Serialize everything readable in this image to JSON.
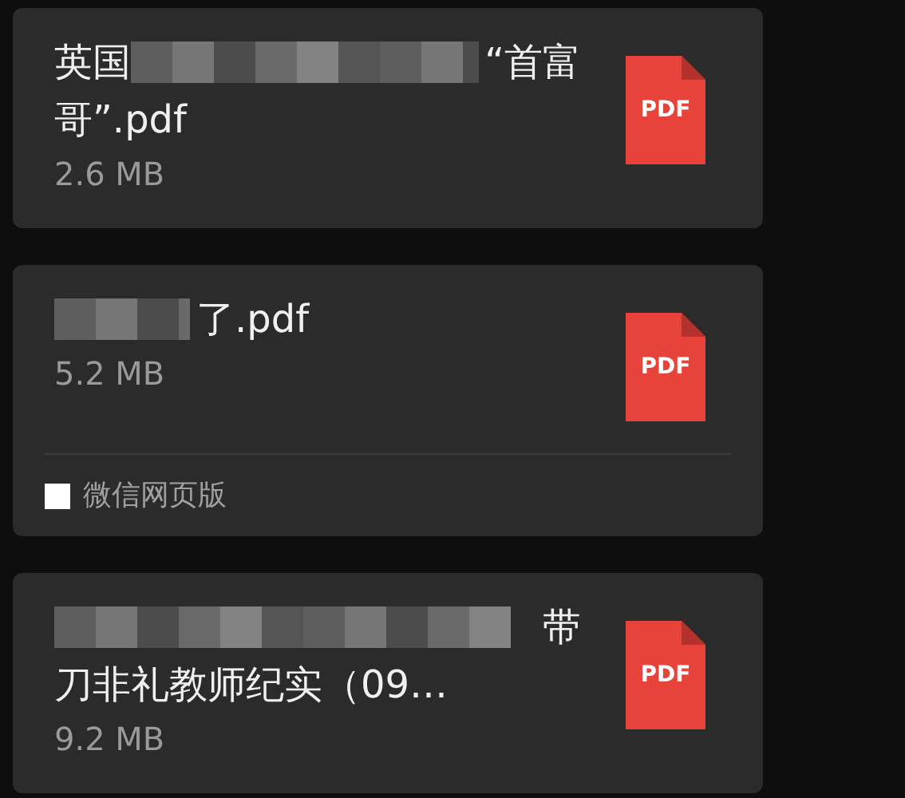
{
  "messages": [
    {
      "title_lines": [
        [
          {
            "kind": "text",
            "text": "英国"
          },
          {
            "kind": "redacted_long"
          },
          {
            "kind": "text",
            "text": "“首富"
          }
        ],
        [
          {
            "kind": "text",
            "text": "哥”.pdf"
          }
        ]
      ],
      "size": "2.6 MB",
      "file_icon": "PDF"
    },
    {
      "title_lines": [
        [
          {
            "kind": "redacted_short"
          },
          {
            "kind": "text",
            "text": "了.pdf"
          }
        ]
      ],
      "size": "5.2 MB",
      "file_icon": "PDF",
      "source": "微信网页版"
    },
    {
      "title_lines": [
        [
          {
            "kind": "redacted_long"
          },
          {
            "kind": "text",
            "text": "带"
          }
        ],
        [
          {
            "kind": "text",
            "text": "刀非礼教师纪实（09…"
          }
        ]
      ],
      "size": "9.2 MB",
      "file_icon": "PDF"
    }
  ]
}
